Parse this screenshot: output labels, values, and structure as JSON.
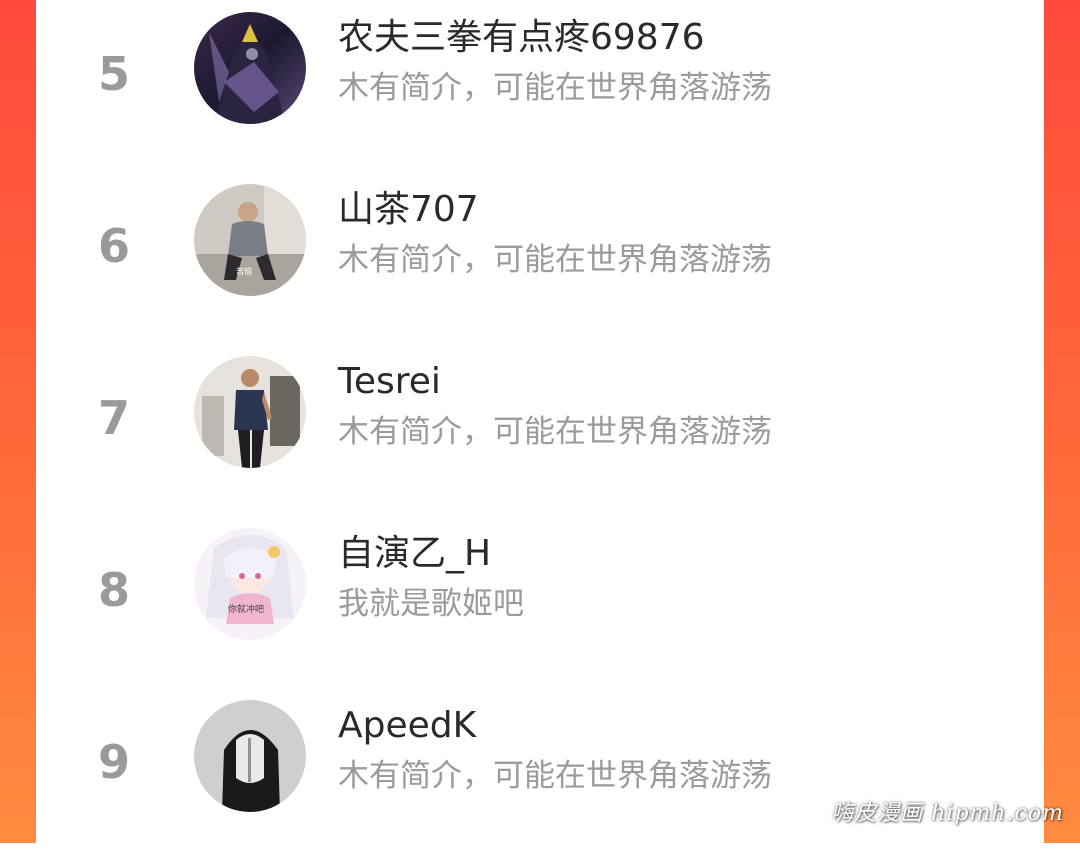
{
  "ranking": {
    "items": [
      {
        "rank": "5",
        "name": "农夫三拳有点疼69876",
        "bio": "木有简介，可能在世界角落游荡",
        "avatar": "dark-anime-knight-avatar"
      },
      {
        "rank": "6",
        "name": "山茶707",
        "bio": "木有简介，可能在世界角落游荡",
        "avatar": "seated-man-photo-avatar",
        "avatar_caption": "苦恼"
      },
      {
        "rank": "7",
        "name": "Tesrei",
        "bio": "木有简介，可能在世界角落游荡",
        "avatar": "standing-man-photo-avatar"
      },
      {
        "rank": "8",
        "name": "自演乙_H",
        "bio": "我就是歌姬吧",
        "avatar": "anime-girl-avatar",
        "avatar_caption": "你就冲吧"
      },
      {
        "rank": "9",
        "name": "ApeedK",
        "bio": "木有简介，可能在世界角落游荡",
        "avatar": "grayscale-portrait-avatar"
      }
    ]
  },
  "watermark": "嗨皮漫画 hipmh.com",
  "colors": {
    "frame_top": "#ff4a3d",
    "frame_bottom": "#ff8c40",
    "rank": "#9a9a9a",
    "name": "#2a2a2a",
    "bio": "#9b9b9b"
  }
}
